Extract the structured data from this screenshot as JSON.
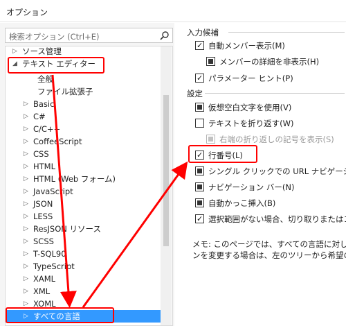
{
  "window": {
    "title": "オプション"
  },
  "search": {
    "placeholder": "検索オプション (Ctrl+E)"
  },
  "tree": {
    "items": [
      {
        "label": "ソース管理",
        "arrow": "▷",
        "level": 0
      },
      {
        "label": "テキスト エディター",
        "arrow": "◢",
        "level": 0
      },
      {
        "label": "全般",
        "arrow": "",
        "level": 2
      },
      {
        "label": "ファイル拡張子",
        "arrow": "",
        "level": 2
      },
      {
        "label": "Basic",
        "arrow": "▷",
        "level": 1
      },
      {
        "label": "C#",
        "arrow": "▷",
        "level": 1
      },
      {
        "label": "C/C++",
        "arrow": "▷",
        "level": 1
      },
      {
        "label": "CoffeeScript",
        "arrow": "▷",
        "level": 1
      },
      {
        "label": "CSS",
        "arrow": "▷",
        "level": 1
      },
      {
        "label": "HTML",
        "arrow": "▷",
        "level": 1
      },
      {
        "label": "HTML (Web フォーム)",
        "arrow": "▷",
        "level": 1
      },
      {
        "label": "JavaScript",
        "arrow": "▷",
        "level": 1
      },
      {
        "label": "JSON",
        "arrow": "▷",
        "level": 1
      },
      {
        "label": "LESS",
        "arrow": "▷",
        "level": 1
      },
      {
        "label": "ResJSON リソース",
        "arrow": "▷",
        "level": 1
      },
      {
        "label": "SCSS",
        "arrow": "▷",
        "level": 1
      },
      {
        "label": "T-SQL90",
        "arrow": "▷",
        "level": 1
      },
      {
        "label": "TypeScript",
        "arrow": "▷",
        "level": 1
      },
      {
        "label": "XAML",
        "arrow": "▷",
        "level": 1
      },
      {
        "label": "XML",
        "arrow": "▷",
        "level": 1
      },
      {
        "label": "XOML",
        "arrow": "▷",
        "level": 1
      },
      {
        "label": "すべての言語",
        "arrow": "▷",
        "level": 1,
        "selected": true
      }
    ]
  },
  "settings": {
    "section_intellisense": "入力候補",
    "auto_list_members": "自動メンバー表示(M)",
    "hide_advanced_members": "メンバーの詳細を非表示(H)",
    "parameter_info": "パラメーター ヒント(P)",
    "section_settings": "設定",
    "virtual_space": "仮想空白文字を使用(V)",
    "word_wrap": "テキストを折り返す(W)",
    "show_wrap_glyphs": "右端の折り返しの記号を表示(S)",
    "line_numbers": "行番号(L)",
    "single_click_url": "シングル クリックでの URL ナビゲーションを有効",
    "navigation_bar": "ナビゲーション バー(N)",
    "auto_brace": "自動かっこ挿入(B)",
    "copy_cut_no_selection": "選択範囲がない場合、切り取りまたはコピー",
    "note_line1": "メモ: このページでは、すべての言語に対してオプシ",
    "note_line2": "ンを変更する場合は、左のツリーから希望の言語"
  },
  "colors": {
    "annotation": "#ff0000",
    "selection": "#3399ff"
  }
}
